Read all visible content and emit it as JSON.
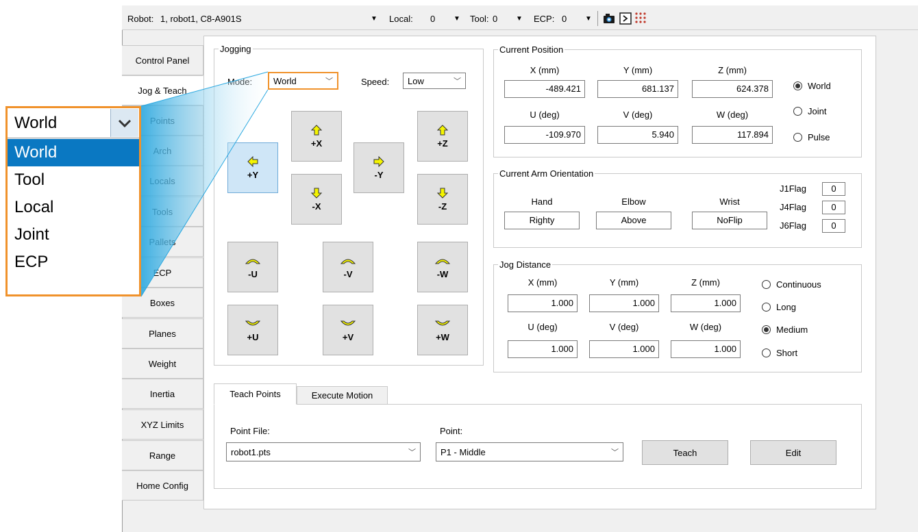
{
  "toolbar": {
    "robot_label": "Robot:",
    "robot_value": "1, robot1, C8-A901S",
    "local_label": "Local:",
    "local_value": "0",
    "tool_label": "Tool:",
    "tool_value": "0",
    "ecp_label": "ECP:",
    "ecp_value": "0",
    "icons": [
      "camera-icon",
      "terminal-icon",
      "io-grid-icon"
    ]
  },
  "tabs": [
    {
      "label": "Control Panel"
    },
    {
      "label": "Jog & Teach",
      "active": true
    },
    {
      "label": "Points"
    },
    {
      "label": "Arch"
    },
    {
      "label": "Locals"
    },
    {
      "label": "Tools"
    },
    {
      "label": "Pallets"
    },
    {
      "label": "ECP"
    },
    {
      "label": "Boxes"
    },
    {
      "label": "Planes"
    },
    {
      "label": "Weight"
    },
    {
      "label": "Inertia"
    },
    {
      "label": "XYZ Limits"
    },
    {
      "label": "Range"
    },
    {
      "label": "Home Config"
    }
  ],
  "jogging": {
    "title": "Jogging",
    "mode_label": "Mode:",
    "mode_value": "World",
    "speed_label": "Speed:",
    "speed_value": "Low",
    "buttons": {
      "plus_x": "+X",
      "minus_x": "-X",
      "plus_y": "+Y",
      "minus_y": "-Y",
      "plus_z": "+Z",
      "minus_z": "-Z",
      "minus_u": "-U",
      "minus_v": "-V",
      "minus_w": "-W",
      "plus_u": "+U",
      "plus_v": "+V",
      "plus_w": "+W"
    },
    "arrow_color": "#f5f500"
  },
  "current_position": {
    "title": "Current Position",
    "headers": [
      "X (mm)",
      "Y (mm)",
      "Z (mm)",
      "U (deg)",
      "V (deg)",
      "W (deg)"
    ],
    "values": [
      "-489.421",
      "681.137",
      "624.378",
      "-109.970",
      "5.940",
      "117.894"
    ],
    "modes": [
      "World",
      "Joint",
      "Pulse"
    ],
    "selected_mode": "World"
  },
  "arm_orientation": {
    "title": "Current Arm Orientation",
    "hand_label": "Hand",
    "hand_value": "Righty",
    "elbow_label": "Elbow",
    "elbow_value": "Above",
    "wrist_label": "Wrist",
    "wrist_value": "NoFlip",
    "flags": [
      {
        "label": "J1Flag",
        "value": "0"
      },
      {
        "label": "J4Flag",
        "value": "0"
      },
      {
        "label": "J6Flag",
        "value": "0"
      }
    ]
  },
  "jog_distance": {
    "title": "Jog Distance",
    "headers": [
      "X (mm)",
      "Y (mm)",
      "Z (mm)",
      "U (deg)",
      "V (deg)",
      "W (deg)"
    ],
    "values": [
      "1.000",
      "1.000",
      "1.000",
      "1.000",
      "1.000",
      "1.000"
    ],
    "modes": [
      "Continuous",
      "Long",
      "Medium",
      "Short"
    ],
    "selected_mode": "Medium"
  },
  "bottom_tabs": {
    "teach_points": "Teach Points",
    "execute_motion": "Execute Motion",
    "point_file_label": "Point File:",
    "point_file_value": "robot1.pts",
    "point_label": "Point:",
    "point_value": "P1 - Middle",
    "teach_button": "Teach",
    "edit_button": "Edit"
  },
  "callout": {
    "selected_value": "World",
    "options": [
      "World",
      "Tool",
      "Local",
      "Joint",
      "ECP"
    ],
    "highlighted_option": "World",
    "highlight_color": "#f0922b"
  }
}
